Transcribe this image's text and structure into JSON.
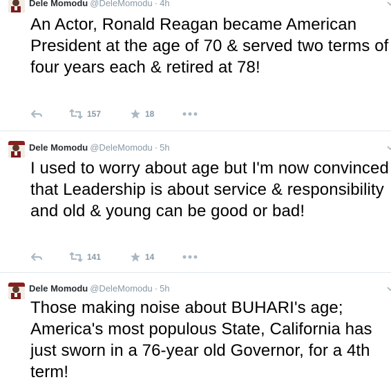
{
  "tweets": [
    {
      "name": "Dele Momodu",
      "handle": "@DeleMomodu",
      "separator": "·",
      "time": "4h",
      "text": "An Actor, Ronald Reagan became American President at the age of 70 & served two terms of four years each & retired at 78!",
      "retweets": "157",
      "favorites": "18"
    },
    {
      "name": "Dele Momodu",
      "handle": "@DeleMomodu",
      "separator": "·",
      "time": "5h",
      "text": "I used to worry about age but I'm now convinced that Leadership is about service & responsibility and old & young can be good or bad!",
      "retweets": "141",
      "favorites": "14"
    },
    {
      "name": "Dele Momodu",
      "handle": "@DeleMomodu",
      "separator": "·",
      "time": "5h",
      "text": "Those making noise about BUHARI's age; America's most populous State, California has just sworn in a 76-year old Governor, for a 4th term!",
      "retweets": "",
      "favorites": ""
    }
  ],
  "icons": {
    "reply": "reply-icon",
    "retweet": "retweet-icon",
    "favorite": "star-icon",
    "more": "more-icon",
    "caret": "chevron-down-icon"
  },
  "colors": {
    "text": "#000000",
    "name": "#292f33",
    "meta": "#8899a6",
    "divider": "#e1e8ed"
  }
}
